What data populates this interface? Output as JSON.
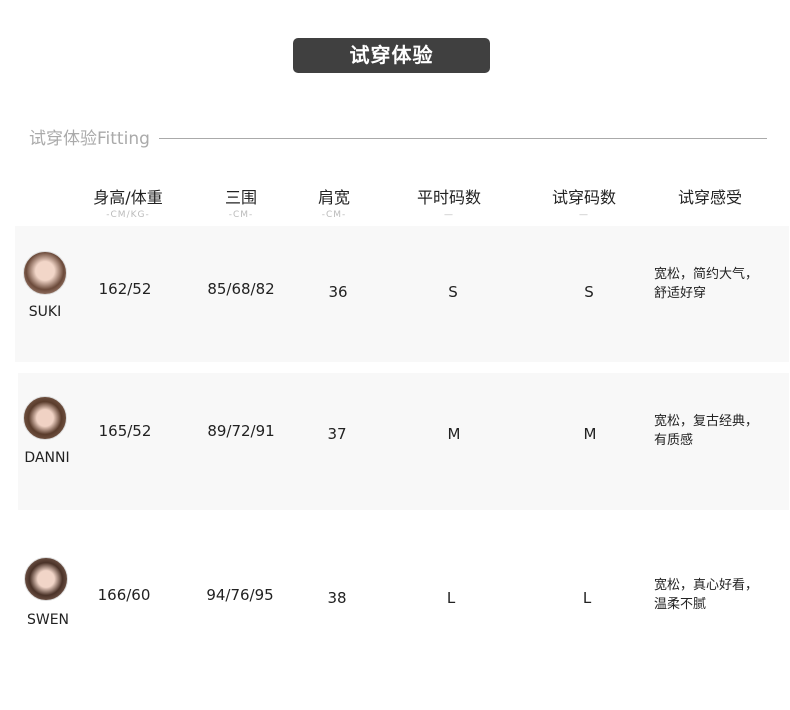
{
  "title": "试穿体验",
  "subtitle": "试穿体验Fitting",
  "headers": [
    {
      "label": "身高/体重",
      "unit": "-CM/KG-"
    },
    {
      "label": "三围",
      "unit": "-CM-"
    },
    {
      "label": "肩宽",
      "unit": "-CM-"
    },
    {
      "label": "平时码数",
      "unit": "—"
    },
    {
      "label": "试穿码数",
      "unit": "—"
    },
    {
      "label": "试穿感受",
      "unit": ""
    }
  ],
  "rows": [
    {
      "name": "SUKI",
      "hw": "162/52",
      "bust": "85/68/82",
      "shoulder": "36",
      "usual": "S",
      "tried": "S",
      "feel1": "宽松，简约大气，",
      "feel2": "舒适好穿"
    },
    {
      "name": "DANNI",
      "hw": "165/52",
      "bust": "89/72/91",
      "shoulder": "37",
      "usual": "M",
      "tried": "M",
      "feel1": "宽松，复古经典，",
      "feel2": "有质感"
    },
    {
      "name": "SWEN",
      "hw": "166/60",
      "bust": "94/76/95",
      "shoulder": "38",
      "usual": "L",
      "tried": "L",
      "feel1": "宽松，真心好看，",
      "feel2": "温柔不腻"
    }
  ]
}
